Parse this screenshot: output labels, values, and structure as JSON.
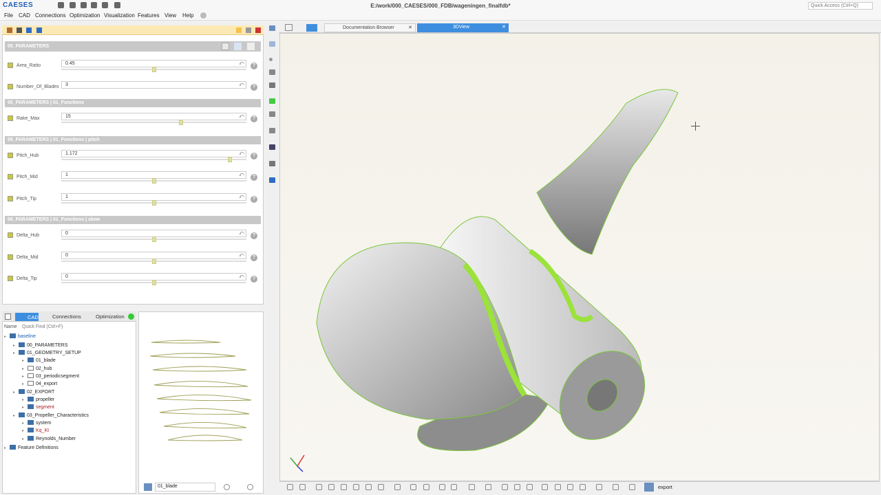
{
  "app": {
    "logo": "CAESES",
    "window_title": "E:/work/000_CAESES/000_FDB/wageningen_finalfdb*",
    "quick_access": "Quick Access (Ctrl+Q)"
  },
  "menu": [
    "File",
    "CAD",
    "Connections",
    "Optimization",
    "Visualization",
    "Features",
    "View",
    "Help"
  ],
  "params": {
    "sections": [
      {
        "title": "00_PARAMETERS"
      },
      {
        "title": "00_PARAMETERS | 01_Functions"
      },
      {
        "title": "00_PARAMETERS | 01_Functions | pitch"
      },
      {
        "title": "00_PARAMETERS | 01_Functions | skew"
      }
    ],
    "rows": [
      {
        "label": "Area_Ratio",
        "value": "0.45",
        "slider": 0.5
      },
      {
        "label": "Number_Of_Blades",
        "value": "3",
        "slider": null
      },
      {
        "label": "Rake_Max",
        "value": "15",
        "slider": 0.65
      },
      {
        "label": "Pitch_Hub",
        "value": "1.172",
        "slider": 0.92
      },
      {
        "label": "Pitch_Mid",
        "value": "1",
        "slider": 0.5
      },
      {
        "label": "Pitch_Tip",
        "value": "1",
        "slider": 0.5
      },
      {
        "label": "Delta_Hub",
        "value": "0",
        "slider": 0.5
      },
      {
        "label": "Delta_Mid",
        "value": "0",
        "slider": 0.5
      },
      {
        "label": "Delta_Tip",
        "value": "0",
        "slider": 0.5
      }
    ]
  },
  "tree": {
    "tabs": [
      "CAD",
      "Connections",
      "Optimization"
    ],
    "name_header": "Name",
    "quickfind": "Quick Find (Ctrl+F)",
    "items": [
      {
        "label": "baseline",
        "indent": 0
      },
      {
        "label": "00_PARAMETERS",
        "indent": 1
      },
      {
        "label": "01_GEOMETRY_SETUP",
        "indent": 1
      },
      {
        "label": "01_blade",
        "indent": 2
      },
      {
        "label": "02_hub",
        "indent": 2
      },
      {
        "label": "03_periodicsegment",
        "indent": 2
      },
      {
        "label": "04_export",
        "indent": 2
      },
      {
        "label": "02_EXPORT",
        "indent": 1
      },
      {
        "label": "propeller",
        "indent": 2
      },
      {
        "label": "segment",
        "indent": 2
      },
      {
        "label": "03_Propeller_Characteristics",
        "indent": 1
      },
      {
        "label": "system",
        "indent": 2
      },
      {
        "label": "Kq_Kt",
        "indent": 2
      },
      {
        "label": "Reynolds_Number",
        "indent": 2
      },
      {
        "label": "Feature Definitions",
        "indent": 0
      }
    ]
  },
  "profile": {
    "selected": "01_blade"
  },
  "tabs": {
    "doc": "Documentation Browser",
    "view": "3DView"
  },
  "bottom": {
    "export_label": "export"
  },
  "colors": {
    "accent": "#1e5fb4",
    "highlight": "#9be23a",
    "toolbar": "#fce9b4"
  }
}
